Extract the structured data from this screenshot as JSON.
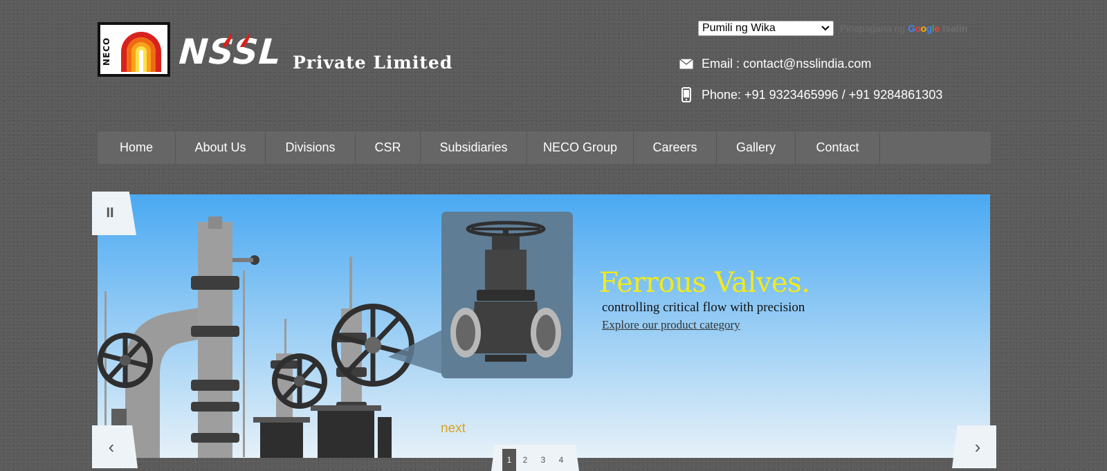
{
  "logo": {
    "badge_text": "NECO",
    "wordmark": "NSSL",
    "subtitle": "Private Limited"
  },
  "translate": {
    "selected_language": "Pumili ng Wika",
    "powered_by": "Pinapagana ng",
    "google": "Google",
    "translate_link": "Isalin"
  },
  "contact": {
    "email": "Email : contact@nsslindia.com",
    "phone": "Phone: +91 9323465996 / +91 9284861303"
  },
  "nav": {
    "items": [
      {
        "label": "Home"
      },
      {
        "label": "About Us"
      },
      {
        "label": "Divisions"
      },
      {
        "label": "CSR"
      },
      {
        "label": "Subsidiaries"
      },
      {
        "label": "NECO Group"
      },
      {
        "label": "Careers"
      },
      {
        "label": "Gallery"
      },
      {
        "label": "Contact"
      }
    ]
  },
  "slider": {
    "title": "Ferrous Valves.",
    "subtitle": "controlling critical flow with precision",
    "link": "Explore our product category",
    "next_label": "next",
    "pause_symbol": "II",
    "prev_symbol": "‹",
    "next_symbol": "›",
    "pages": [
      "1",
      "2",
      "3",
      "4"
    ],
    "active_page": "1"
  },
  "colors": {
    "background": "#5b5b5b",
    "nav_background": "#666666",
    "sky_top": "#4aa9f2",
    "sky_bottom": "#e6f1f8",
    "title_yellow": "#f2ea1b",
    "next_gold": "#d9a21e",
    "logo_red": "#d8221c"
  },
  "icons": {
    "email": "envelope-icon",
    "phone": "mobile-phone-icon",
    "select": "chevron-down-icon"
  }
}
